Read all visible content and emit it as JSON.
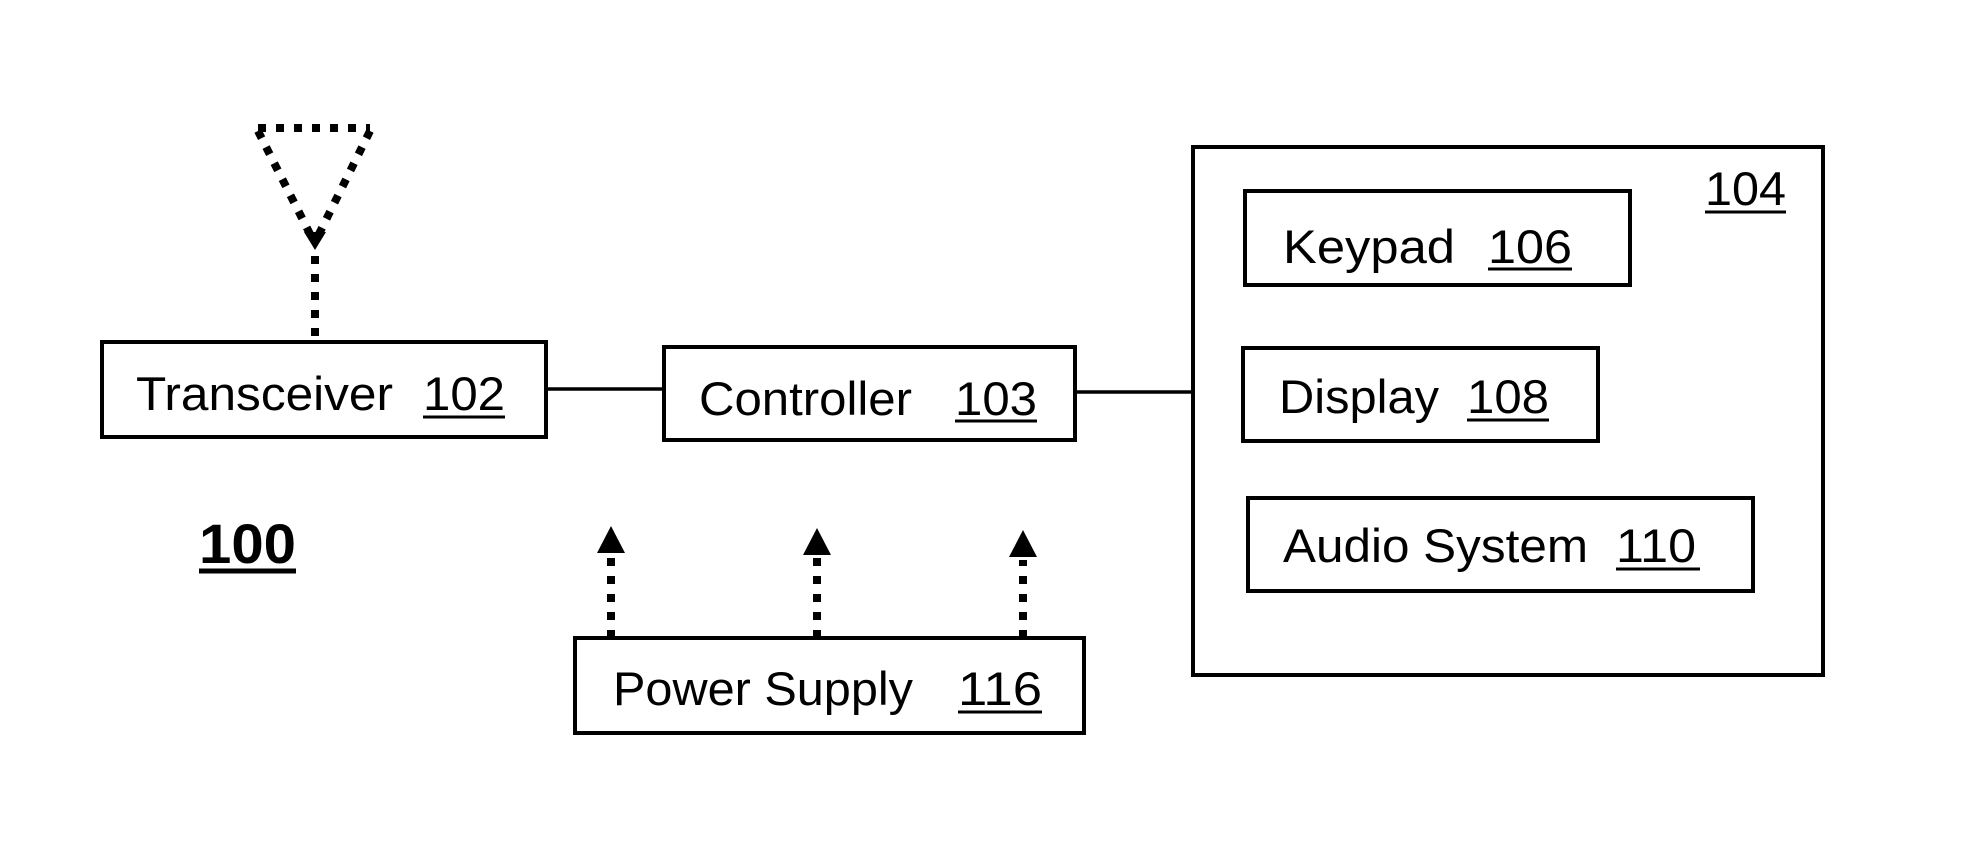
{
  "diagram": {
    "figure_label": "100",
    "nodes": {
      "transceiver": {
        "label": "Transceiver",
        "ref": "102"
      },
      "controller": {
        "label": "Controller",
        "ref": "103"
      },
      "user_interface": {
        "label": "",
        "ref": "104"
      },
      "keypad": {
        "label": "Keypad",
        "ref": "106"
      },
      "display": {
        "label": "Display",
        "ref": "108"
      },
      "audio_system": {
        "label": "Audio System",
        "ref": "110"
      },
      "power_supply": {
        "label": "Power Supply",
        "ref": "116"
      }
    },
    "antenna": {
      "icon": "antenna-icon",
      "style": "dotted"
    },
    "connections": [
      {
        "from": "Transceiver",
        "to": "Controller",
        "style": "solid"
      },
      {
        "from": "Controller",
        "to": "104",
        "style": "solid"
      },
      {
        "from": "Antenna",
        "to": "Transceiver",
        "style": "dotted"
      },
      {
        "from": "Power Supply",
        "to": "up",
        "style": "dotted-arrow",
        "count": 3
      }
    ]
  }
}
